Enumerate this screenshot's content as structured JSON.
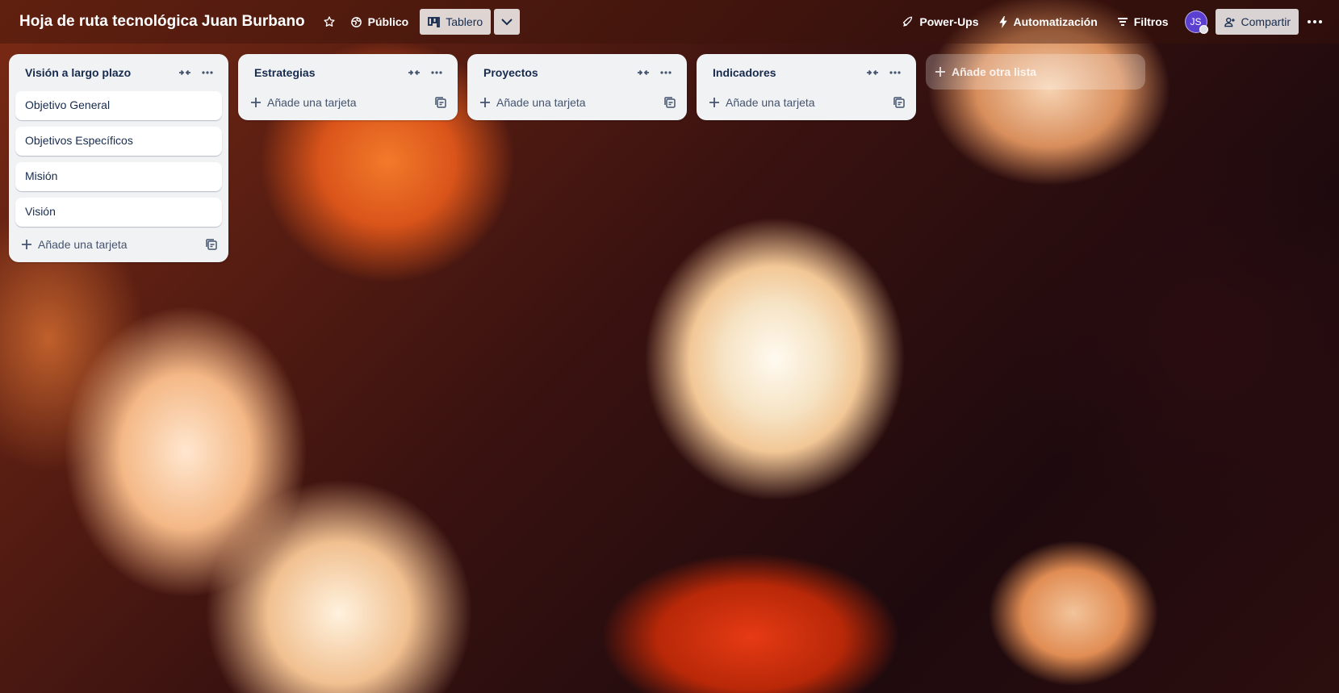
{
  "header": {
    "board_title": "Hoja de ruta tecnológica Juan Burbano",
    "visibility_label": "Público",
    "view_label": "Tablero",
    "powerups_label": "Power-Ups",
    "automation_label": "Automatización",
    "filters_label": "Filtros",
    "avatar_initials": "JS",
    "share_label": "Compartir"
  },
  "lists": [
    {
      "title": "Visión a largo plazo",
      "cards": [
        "Objetivo General",
        "Objetivos Específicos",
        "Misión",
        "Visión"
      ],
      "add_card_label": "Añade una tarjeta"
    },
    {
      "title": "Estrategias",
      "cards": [],
      "add_card_label": "Añade una tarjeta"
    },
    {
      "title": "Proyectos",
      "cards": [],
      "add_card_label": "Añade una tarjeta"
    },
    {
      "title": "Indicadores",
      "cards": [],
      "add_card_label": "Añade una tarjeta"
    }
  ],
  "add_list_label": "Añade otra lista",
  "icons": {
    "star": "star-icon",
    "visibility": "globe-icon",
    "view": "board-icon",
    "view_dropdown": "chevron-down-icon",
    "powerups": "rocket-icon",
    "automation": "lightning-icon",
    "filters": "filter-icon",
    "share": "add-person-icon",
    "more": "more-icon",
    "collapse": "collapse-icon",
    "template": "template-icon",
    "add": "plus-icon"
  }
}
